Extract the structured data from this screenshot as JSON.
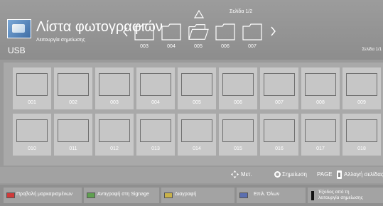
{
  "header": {
    "title": "Λίστα φωτογραφιών",
    "subtitle": "Λειτουργία σημείωσης",
    "device": "USB",
    "page_indicator": "Σελίδα 1/2",
    "page_indicator_right": "Σελίδα 1/1"
  },
  "folders": [
    {
      "label": "003",
      "open": false
    },
    {
      "label": "004",
      "open": false
    },
    {
      "label": "005",
      "open": true
    },
    {
      "label": "006",
      "open": false
    },
    {
      "label": "007",
      "open": false
    }
  ],
  "thumbnails": [
    {
      "label": "001"
    },
    {
      "label": "002"
    },
    {
      "label": "003"
    },
    {
      "label": "004"
    },
    {
      "label": "005"
    },
    {
      "label": "006"
    },
    {
      "label": "007"
    },
    {
      "label": "008"
    },
    {
      "label": "009"
    },
    {
      "label": "010"
    },
    {
      "label": "011"
    },
    {
      "label": "012"
    },
    {
      "label": "013"
    },
    {
      "label": "014"
    },
    {
      "label": "015"
    },
    {
      "label": "016"
    },
    {
      "label": "017"
    },
    {
      "label": "018"
    }
  ],
  "status": {
    "move": "Μετ.",
    "mark": "Σημείωση",
    "page_key": "PAGE",
    "change_page": "Αλλαγή σελίδας"
  },
  "bottom_buttons": {
    "view_marked": "Προβολή μαρκαρισμένων",
    "copy_signage": "Αντιγραφή στη Signage",
    "delete": "Διαγραφή",
    "select_all": "Επιλ. Όλων",
    "exit_mark_line1": "Έξοδος από τη",
    "exit_mark_line2": "λειτουργία σημείωσης"
  },
  "colors": {
    "button_red": "#d03a3a",
    "button_green": "#5fa050",
    "button_yellow": "#c9b24a",
    "button_blue": "#5b6fb0"
  }
}
